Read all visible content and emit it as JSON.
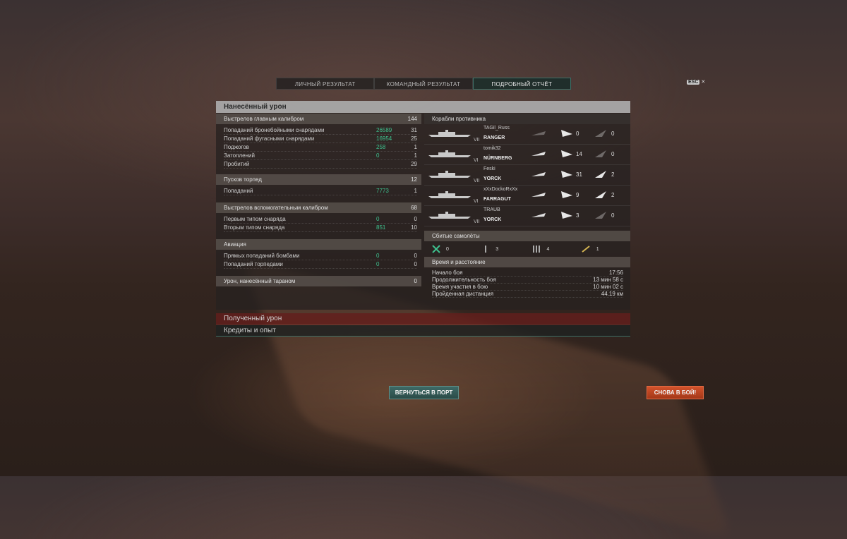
{
  "tabs": [
    "ЛИЧНЫЙ РЕЗУЛЬТАТ",
    "КОМАНДНЫЙ РЕЗУЛЬТАТ",
    "ПОДРОБНЫЙ ОТЧЁТ"
  ],
  "esc": {
    "key": "ESC",
    "close": "✕"
  },
  "panel_title": "Нанесённый урон",
  "main_battery": {
    "label": "Выстрелов главным калибром",
    "value": "144",
    "rows": [
      {
        "label": "Попаданий бронебойными снарядами",
        "dmg": "26589",
        "n": "31"
      },
      {
        "label": "Попаданий фугасными снарядами",
        "dmg": "16954",
        "n": "25"
      },
      {
        "label": "Поджогов",
        "dmg": "258",
        "n": "1"
      },
      {
        "label": "Затоплений",
        "dmg": "0",
        "n": "1"
      },
      {
        "label": "Пробитий",
        "dmg": "",
        "n": "29"
      }
    ]
  },
  "torpedoes": {
    "label": "Пусков торпед",
    "value": "12",
    "rows": [
      {
        "label": "Попаданий",
        "dmg": "7773",
        "n": "1"
      }
    ]
  },
  "secondary": {
    "label": "Выстрелов вспомогательным калибром",
    "value": "68",
    "rows": [
      {
        "label": "Первым типом снаряда",
        "dmg": "0",
        "n": "0"
      },
      {
        "label": "Вторым типом снаряда",
        "dmg": "851",
        "n": "10"
      }
    ]
  },
  "aviation": {
    "label": "Авиация",
    "rows": [
      {
        "label": "Прямых попаданий бомбами",
        "dmg": "0",
        "n": "0"
      },
      {
        "label": "Попаданий торпедами",
        "dmg": "0",
        "n": "0"
      }
    ]
  },
  "ram": {
    "label": "Урон, нанесённый тараном",
    "value": "0"
  },
  "enemies_title": "Корабли противника",
  "enemies": [
    {
      "tier": "VII",
      "player": "TAGil_Russ",
      "ship": "RANGER",
      "spotted": "0",
      "killed": "0",
      "dim": true
    },
    {
      "tier": "VI",
      "player": "tomik32",
      "ship": "NÜRNBERG",
      "spotted": "14",
      "killed": "0",
      "dim": false
    },
    {
      "tier": "VII",
      "player": "Feski",
      "ship": "YORCK",
      "spotted": "31",
      "killed": "2",
      "dim": false
    },
    {
      "tier": "VI",
      "player": "xXxDockoRxXx",
      "ship": "FARRAGUT",
      "spotted": "9",
      "killed": "2",
      "dim": false
    },
    {
      "tier": "VII",
      "player": "TRAUB",
      "ship": "YORCK",
      "spotted": "3",
      "killed": "0",
      "dim": false
    }
  ],
  "planes_title": "Сбитые самолёты",
  "planes": [
    "0",
    "3",
    "4",
    "1"
  ],
  "time_title": "Время и расстояние",
  "time_rows": [
    {
      "label": "Начало боя",
      "value": "17:56"
    },
    {
      "label": "Продолжительность боя",
      "value": "13 мин 58 с"
    },
    {
      "label": "Время участия в бою",
      "value": "10 мин 02 с"
    },
    {
      "label": "Пройденная дистанция",
      "value": "44.19 км"
    }
  ],
  "received_damage": "Полученный урон",
  "credits_xp": "Кредиты и опыт",
  "buttons": {
    "port": "ВЕРНУТЬСЯ В ПОРТ",
    "battle": "СНОВА В БОЙ!"
  },
  "colors": {
    "accent_green": "#3ec08e",
    "battle_button": "#c8471f",
    "port_button": "#355b58"
  }
}
